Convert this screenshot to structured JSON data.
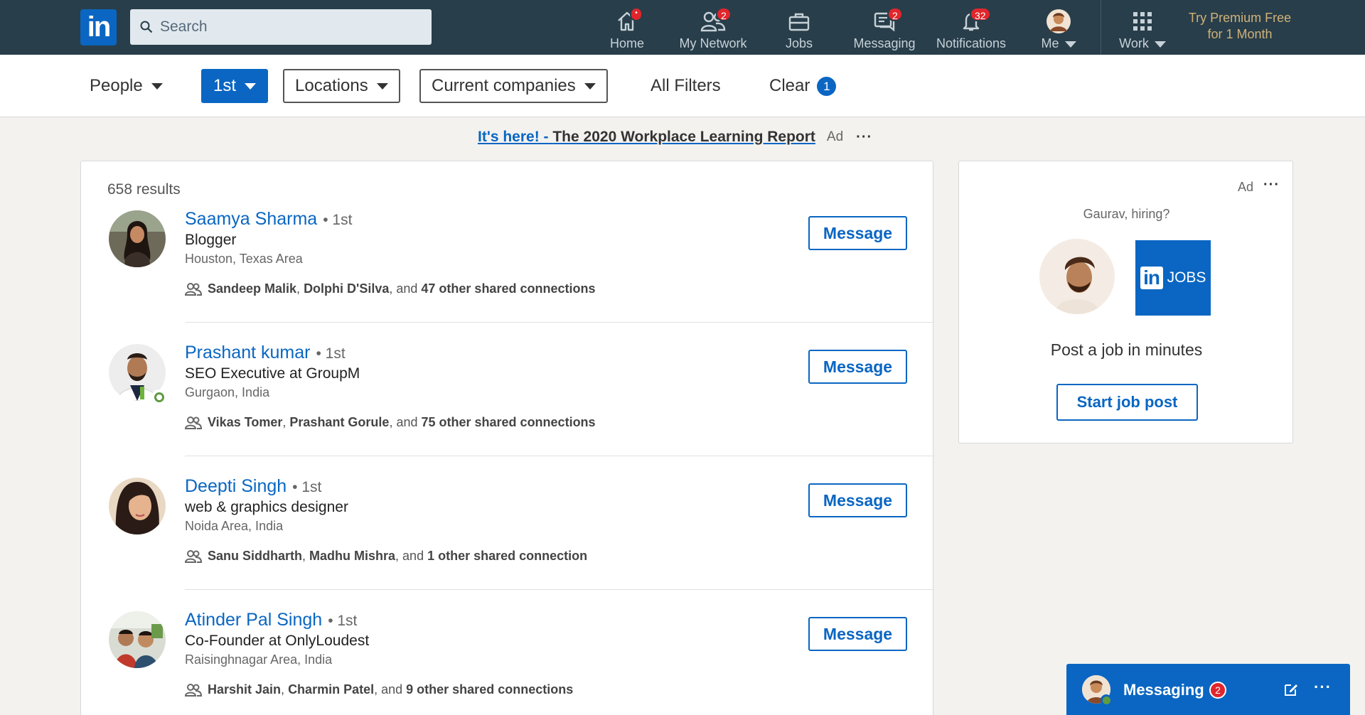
{
  "colors": {
    "nav_bg": "#283e4a",
    "brand": "#0a66c2",
    "badge": "#e0262c",
    "premium": "#d0b179",
    "online": "#5f9b41"
  },
  "nav": {
    "logo_text": "in",
    "search_placeholder": "Search",
    "items": [
      {
        "label": "Home",
        "icon": "home-icon",
        "badge": "•"
      },
      {
        "label": "My Network",
        "icon": "network-icon",
        "badge": "2"
      },
      {
        "label": "Jobs",
        "icon": "briefcase-icon",
        "badge": ""
      },
      {
        "label": "Messaging",
        "icon": "messaging-icon",
        "badge": "2"
      },
      {
        "label": "Notifications",
        "icon": "bell-icon",
        "badge": "32"
      },
      {
        "label": "Me",
        "icon": "avatar-icon",
        "badge": ""
      },
      {
        "label": "Work",
        "icon": "grid-icon",
        "badge": ""
      }
    ],
    "premium_line1": "Try Premium Free",
    "premium_line2": "for 1 Month"
  },
  "filters": {
    "people": "People",
    "connection": "1st",
    "locations": "Locations",
    "companies": "Current companies",
    "all_filters": "All Filters",
    "clear": "Clear",
    "clear_count": "1"
  },
  "ad_banner": {
    "highlight": "It's here! - ",
    "text": "The 2020 Workplace Learning Report",
    "ad_label": "Ad",
    "more": "···"
  },
  "results": {
    "count": "658 results",
    "people": [
      {
        "name": "Saamya Sharma",
        "degree": "• 1st",
        "headline": "Blogger",
        "location": "Houston, Texas Area",
        "shared_a": "Sandeep Malik",
        "shared_b": "Dolphi D'Silva",
        "shared_and": ", and ",
        "shared_other": "47 other shared connections",
        "button": "Message",
        "online": false
      },
      {
        "name": "Prashant kumar",
        "degree": "• 1st",
        "headline": "SEO Executive at GroupM",
        "location": "Gurgaon, India",
        "shared_a": "Vikas Tomer",
        "shared_b": "Prashant Gorule",
        "shared_and": ", and ",
        "shared_other": "75 other shared connections",
        "button": "Message",
        "online": true
      },
      {
        "name": "Deepti Singh",
        "degree": "• 1st",
        "headline": "web & graphics designer",
        "location": "Noida Area, India",
        "shared_a": "Sanu Siddharth",
        "shared_b": "Madhu Mishra",
        "shared_and": ", and ",
        "shared_other": "1 other shared connection",
        "button": "Message",
        "online": false
      },
      {
        "name": "Atinder Pal Singh",
        "degree": "• 1st",
        "headline": "Co-Founder at OnlyLoudest",
        "location": "Raisinghnagar Area, India",
        "shared_a": "Harshit Jain",
        "shared_b": "Charmin Patel",
        "shared_and": ", and ",
        "shared_other": "9 other shared connections",
        "button": "Message",
        "online": false
      }
    ]
  },
  "side_ad": {
    "ad_label": "Ad",
    "more": "···",
    "hiring": "Gaurav, hiring?",
    "logo_in": "in",
    "logo_text": "JOBS",
    "tagline": "Post a job in minutes",
    "cta": "Start job post"
  },
  "messaging_dock": {
    "title": "Messaging",
    "badge": "2",
    "more": "···"
  }
}
